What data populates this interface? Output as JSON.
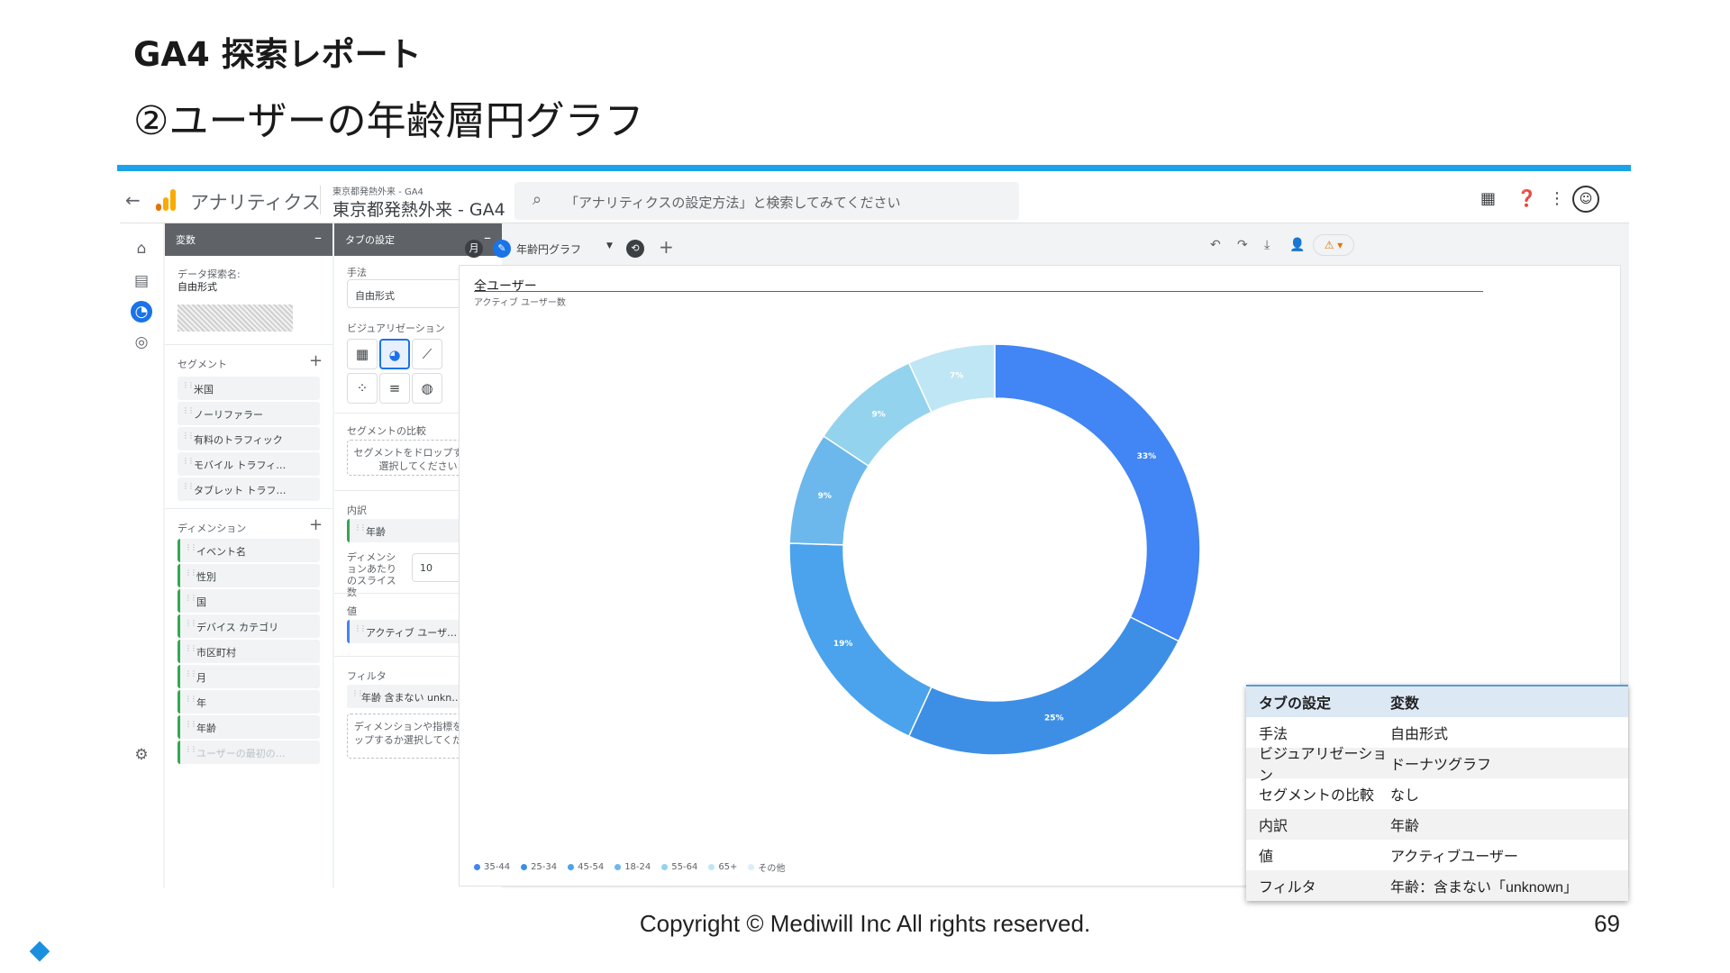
{
  "slide": {
    "title": "GA4 探索レポート",
    "subtitle": "②ユーザーの年齢層円グラフ",
    "copyright": "Copyright © Mediwill Inc All rights reserved.",
    "page_number": "69"
  },
  "topbar": {
    "app_name": "アナリティクス",
    "property_path": "東京都発熱外来 - GA4",
    "property_name": "東京都発熱外来 - GA4",
    "search_placeholder": "「アナリティクスの設定方法」と検索してみてください"
  },
  "variables_panel": {
    "header": "変数",
    "exploration_label": "データ探索名:",
    "exploration_value": "自由形式",
    "segments_label": "セグメント",
    "segments": [
      "米国",
      "ノーリファラー",
      "有料のトラフィック",
      "モバイル トラフィ…",
      "タブレット トラフ…"
    ],
    "dimensions_label": "ディメンション",
    "dimensions": [
      "イベント名",
      "性別",
      "国",
      "デバイス カテゴリ",
      "市区町村",
      "月",
      "年",
      "年齢",
      "ユーザーの最初の…"
    ]
  },
  "tab_settings_panel": {
    "header": "タブの設定",
    "technique_label": "手法",
    "technique_value": "自由形式",
    "visualization_label": "ビジュアリゼーション",
    "segment_compare_label": "セグメントの比較",
    "segment_drop_text": "セグメントをドロップするか選択してください",
    "breakdown_label": "内訳",
    "breakdown_value": "年齢",
    "rows_label": "ディメンションあたりのスライス数",
    "rows_value": "10",
    "values_label": "値",
    "values_value": "アクティブ ユーザ…",
    "filter_label": "フィルタ",
    "filter_value": "年齢 含まない unkn…",
    "filter_drop_text": "ディメンションや指標をドロップするか選択してください"
  },
  "canvas": {
    "tab_name": "年齢円グラフ",
    "title": "全ユーザー",
    "subtitle": "アクティブ ユーザー数"
  },
  "chart_data": {
    "type": "pie",
    "variant": "donut",
    "categories": [
      "35-44",
      "25-34",
      "45-54",
      "18-24",
      "55-64",
      "65+"
    ],
    "values": [
      33,
      25,
      19,
      9,
      9,
      7
    ],
    "labels": [
      "33%",
      "25%",
      "19%",
      "9%",
      "9%",
      "7%"
    ],
    "legend": [
      "35-44",
      "25-34",
      "45-54",
      "18-24",
      "55-64",
      "65+",
      "その他"
    ],
    "colors": [
      "#4285f4",
      "#3d8fe6",
      "#4aa3ec",
      "#6cb8ec",
      "#93d3ee",
      "#bfe6f4",
      "#dceef6"
    ],
    "legend_position": "bottom-left"
  },
  "info_table": {
    "headers": [
      "タブの設定",
      "変数"
    ],
    "rows": [
      [
        "手法",
        "自由形式"
      ],
      [
        "ビジュアリゼーション",
        "ドーナツグラフ"
      ],
      [
        "セグメントの比較",
        "なし"
      ],
      [
        "内訳",
        "年齢"
      ],
      [
        "値",
        "アクティブユーザー"
      ],
      [
        "フィルタ",
        "年齢：含まない「unknown」"
      ]
    ]
  }
}
